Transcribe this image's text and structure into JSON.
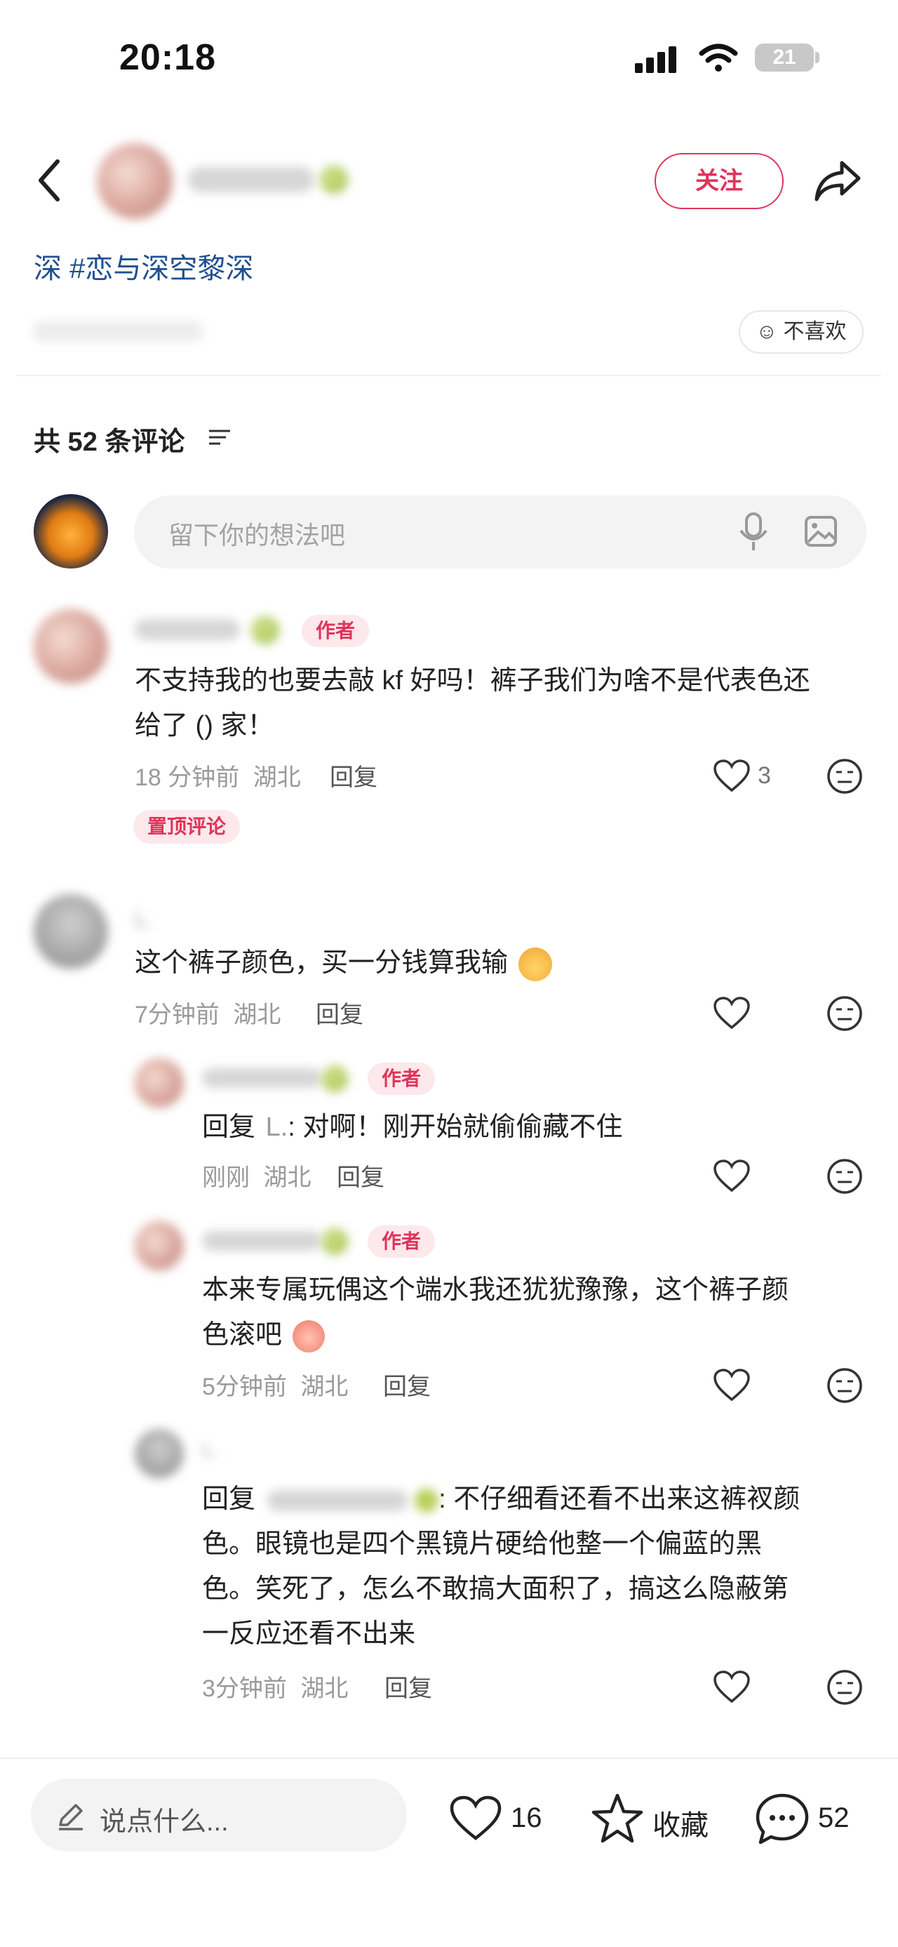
{
  "status_bar": {
    "time": "20:18",
    "battery": "21"
  },
  "header": {
    "follow_label": "关注"
  },
  "post": {
    "tags": "深 #恋与深空黎深"
  },
  "dislike_label": "不喜欢",
  "comments_header": {
    "count_label": "共 52 条评论"
  },
  "comment_input": {
    "placeholder": "留下你的想法吧"
  },
  "comments": [
    {
      "author_tag": "作者",
      "text_line1": "不支持我的也要去敲 kf 好吗！裤子我们为啥不是代表色还",
      "text_line2": "给了 () 家！",
      "time": "18 分钟前",
      "location": "湖北",
      "reply_label": "回复",
      "likes": "3",
      "pinned_label": "置顶评论"
    },
    {
      "username": "L.",
      "text": "这个裤子颜色，买一分钱算我输",
      "time": "7分钟前",
      "location": "湖北",
      "reply_label": "回复",
      "replies": [
        {
          "author_tag": "作者",
          "reply_prefix": "回复",
          "reply_to": "L.",
          "text": ": 对啊！刚开始就偷偷藏不住",
          "time": "刚刚",
          "location": "湖北",
          "reply_label": "回复"
        },
        {
          "author_tag": "作者",
          "text_line1": "本来专属玩偶这个端水我还犹犹豫豫，这个裤子颜",
          "text_line2": "色滚吧",
          "time": "5分钟前",
          "location": "湖北",
          "reply_label": "回复"
        },
        {
          "username": "L.",
          "reply_prefix": "回复",
          "text_line1": ": 不仔细看还看不出来这裤衩颜",
          "text_line2": "色。眼镜也是四个黑镜片硬给他整一个偏蓝的黑",
          "text_line3": "色。笑死了，怎么不敢搞大面积了，搞这么隐蔽第",
          "text_line4": "一反应还看不出来",
          "time": "3分钟前",
          "location": "湖北",
          "reply_label": "回复"
        }
      ]
    }
  ],
  "bottom_bar": {
    "say_placeholder": "说点什么...",
    "likes": "16",
    "favorite_label": "收藏",
    "comments": "52"
  }
}
